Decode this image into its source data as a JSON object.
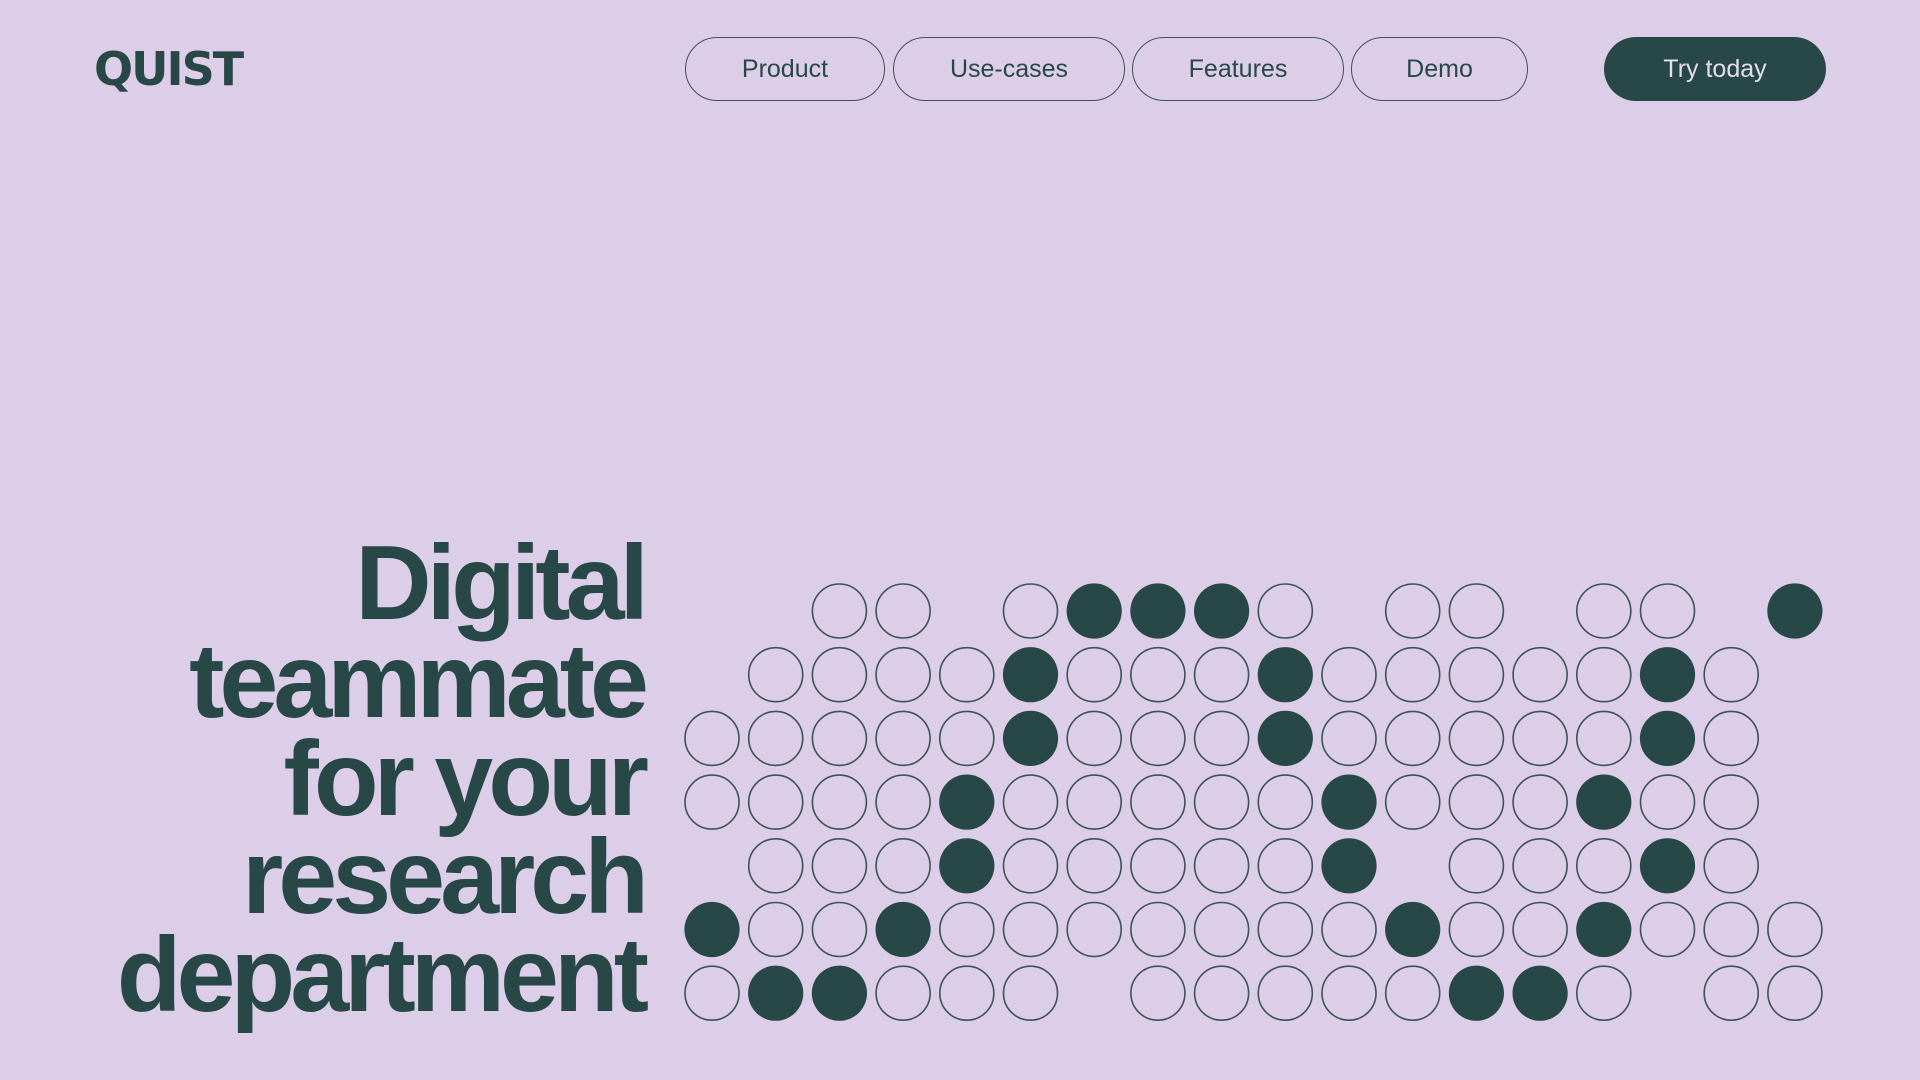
{
  "brand": {
    "logo_text": "QUIST"
  },
  "nav": {
    "items": [
      {
        "label": "Product"
      },
      {
        "label": "Use-cases"
      },
      {
        "label": "Features"
      },
      {
        "label": "Demo"
      }
    ],
    "cta_label": "Try today"
  },
  "hero": {
    "headline_lines": [
      "Digital",
      "teammate",
      "for your",
      "research",
      "department"
    ]
  },
  "dot_grid": {
    "legend": "Each row string: o = outlined circle, x = filled circle, . = empty slot",
    "rows": [
      "..oo.oxxxo.oo.oo.x",
      ".ooooxoooxoooooxo",
      "oooooxoooxoooooxo",
      "ooooxoooooxoooxoo",
      ".oooxooooox.oooxo.",
      "xooxoooooooxooxooo",
      "oxxooo.oooooxxo.oo"
    ],
    "colors": {
      "filled": "#284848",
      "outline": "#3b5458",
      "background": "#dccde8"
    }
  }
}
